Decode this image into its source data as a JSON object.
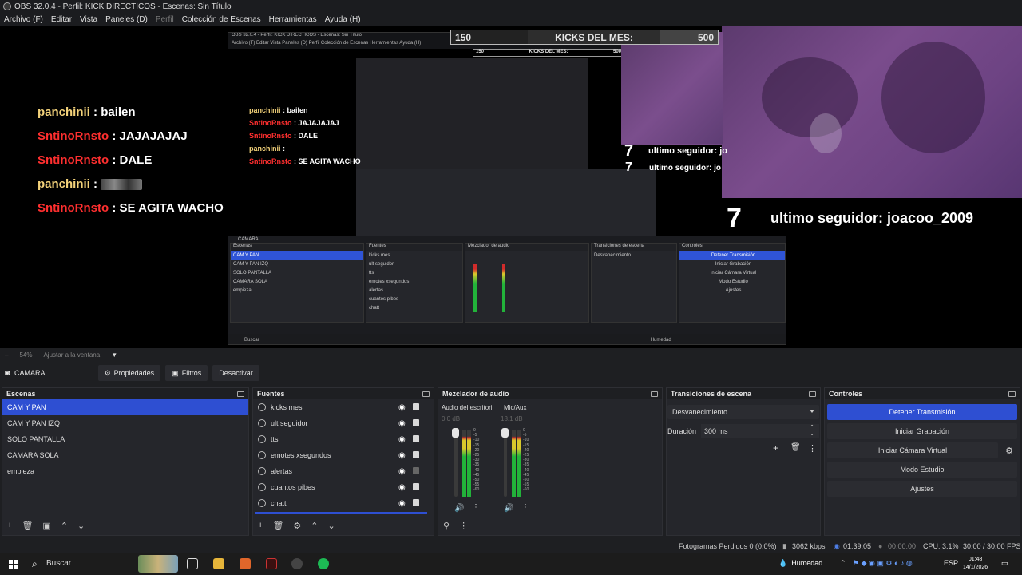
{
  "window": {
    "title": "OBS 32.0.4 - Perfil: KICK DIRECTICOS - Escenas: Sin Título"
  },
  "menu": {
    "items": [
      "Archivo (F)",
      "Editar",
      "Vista",
      "Paneles (D)",
      "Perfil",
      "Colección de Escenas",
      "Herramientas",
      "Ayuda (H)"
    ]
  },
  "overlay": {
    "kicks": {
      "left": "150",
      "label": "KICKS DEL MES:",
      "right": "500"
    },
    "chat": [
      {
        "user": "panchinii",
        "sep": " : ",
        "msg": "bailen",
        "color": "#f3d27a"
      },
      {
        "user": "SntinoRnsto",
        "sep": " : ",
        "msg": "JAJAJAJAJ",
        "color": "#ff2f2f"
      },
      {
        "user": "SntinoRnsto",
        "sep": " : ",
        "msg": "DALE",
        "color": "#ff2f2f"
      },
      {
        "user": "panchinii",
        "sep": " : ",
        "msg": "",
        "color": "#f3d27a"
      },
      {
        "user": "SntinoRnsto",
        "sep": " : ",
        "msg": "SE AGITA WACHO",
        "color": "#ff2f2f"
      }
    ],
    "follower_count": "7",
    "follower_text": "ultimo seguidor: joacoo_2009",
    "nested_follower_text": "ultimo seguidor: jo",
    "nested_chat": [
      {
        "user": "panchinii",
        "sep": " : ",
        "msg": "bailen",
        "color": "#f3d27a"
      },
      {
        "user": "SntinoRnsto",
        "sep": " : ",
        "msg": "JAJAJAJAJ",
        "color": "#ff2f2f"
      },
      {
        "user": "SntinoRnsto",
        "sep": " : ",
        "msg": "DALE",
        "color": "#ff2f2f"
      },
      {
        "user": "panchinii",
        "sep": " : ",
        "msg": "",
        "color": "#f3d27a"
      },
      {
        "user": "SntinoRnsto",
        "sep": " : ",
        "msg": "SE AGITA WACHO",
        "color": "#ff2f2f"
      }
    ]
  },
  "zoom": {
    "percent": "54%",
    "fit": "Ajustar a la ventana"
  },
  "source_toolbar": {
    "name": "CAMARA",
    "properties": "Propiedades",
    "filters": "Filtros",
    "deactivate": "Desactivar"
  },
  "scenes": {
    "title": "Escenas",
    "items": [
      "CAM Y PAN",
      "CAM Y PAN IZQ",
      "SOLO PANTALLA",
      "CAMARA SOLA",
      "empieza"
    ]
  },
  "sources": {
    "title": "Fuentes",
    "items": [
      "kicks mes",
      "ult seguidor",
      "tts",
      "emotes xsegundos",
      "alertas",
      "cuantos pibes",
      "chatt"
    ]
  },
  "mixer": {
    "title": "Mezclador de audio",
    "channels": [
      {
        "name": "Audio del escritori",
        "db": "0.0 dB"
      },
      {
        "name": "Mic/Aux",
        "db": "18.1 dB"
      }
    ],
    "scale": [
      "0",
      "-5",
      "-10",
      "-15",
      "-20",
      "-25",
      "-30",
      "-35",
      "-40",
      "-45",
      "-50",
      "-55",
      "-60"
    ]
  },
  "transitions": {
    "title": "Transiciones de escena",
    "selected": "Desvanecimiento",
    "duration_label": "Duración",
    "duration_value": "300 ms"
  },
  "controls": {
    "title": "Controles",
    "buttons": [
      "Detener Transmisión",
      "Iniciar Grabación",
      "Iniciar Cámara Virtual",
      "Modo Estudio",
      "Ajustes"
    ]
  },
  "status": {
    "dropped": "Fotogramas Perdidos 0 (0.0%)",
    "bitrate": "3062 kbps",
    "stream_time": "01:39:05",
    "rec_time": "00:00:00",
    "cpu": "CPU: 3.1%",
    "fps": "30.00 / 30.00 FPS"
  },
  "taskbar": {
    "search": "Buscar",
    "weather": "Humedad",
    "lang": "ESP",
    "time": "01:48",
    "date": "14/1/2026"
  },
  "nested": {
    "title": "OBS 32.0.4 - Perfil: KICK DIRECTICOS - Escenas: Sin Título",
    "source_name": "CAMARA",
    "search": "Buscar",
    "weather": "Humedad"
  }
}
